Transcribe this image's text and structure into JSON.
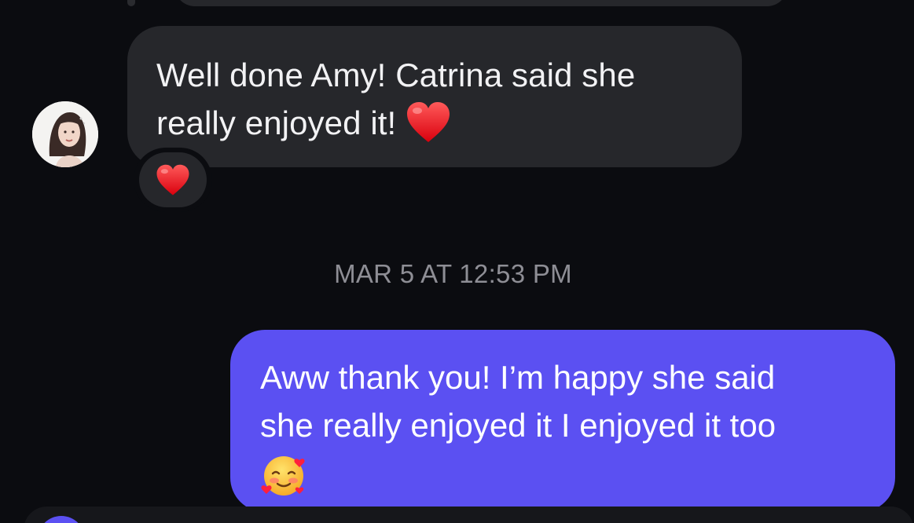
{
  "conversation": {
    "incoming_message": {
      "line1": "Well done Amy! Catrina said she",
      "line2": "really enjoyed it!",
      "inline_emoji": "red-heart",
      "reaction_emoji": "red-heart"
    },
    "timestamp": "MAR 5 AT 12:53 PM",
    "outgoing_message": {
      "line1": "Aww thank you! I’m happy she said",
      "line2": "she really enjoyed it I enjoyed it too",
      "emoji": "smiling-face-with-hearts"
    }
  },
  "colors": {
    "background": "#0b0c10",
    "incoming_bubble": "#26272b",
    "outgoing_bubble": "#5b50f2",
    "timestamp_text": "#8e8e95"
  }
}
